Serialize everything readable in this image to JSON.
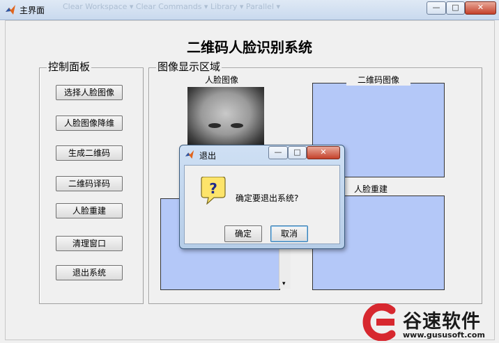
{
  "window": {
    "title": "主界面",
    "ghost_text": "Clear Workspace  ▾     Clear Commands  ▾     Library         ▾     Parallel  ▾"
  },
  "window_buttons": {
    "minimize": "—",
    "maximize": "□",
    "close": "✕"
  },
  "app": {
    "title": "二维码人脸识别系统"
  },
  "control_panel": {
    "legend": "控制面板",
    "buttons": [
      "选择人脸图像",
      "人脸图像降维",
      "生成二维码",
      "二维码译码",
      "人脸重建",
      "清理窗口",
      "退出系统"
    ]
  },
  "display_panel": {
    "legend": "图像显示区域",
    "face_label": "人脸图像",
    "qr_label": "二维码图像",
    "rebuild_label": "人脸重建"
  },
  "dialog": {
    "title": "退出",
    "icon": "question-icon",
    "message": "确定要退出系统?",
    "ok_label": "确定",
    "cancel_label": "取消",
    "question_glyph": "?",
    "scroll_arrow": "▾"
  },
  "watermark": {
    "brand": "谷速软件",
    "url": "www.gususoft.com"
  },
  "colors": {
    "axes_fill": "#b4c8f8",
    "brand_red": "#d7282f"
  }
}
